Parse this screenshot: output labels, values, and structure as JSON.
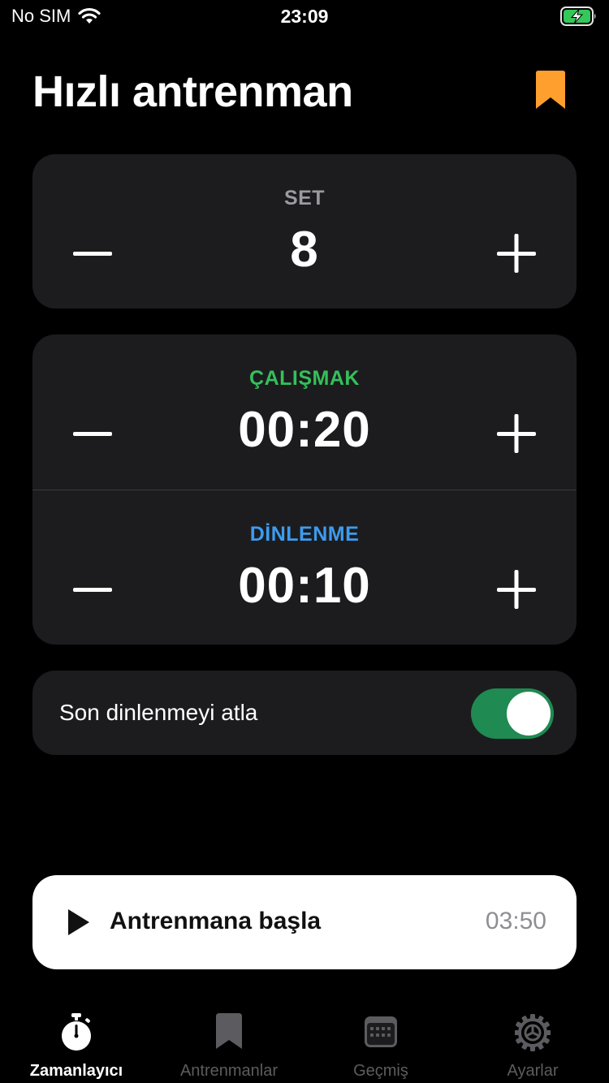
{
  "status_bar": {
    "carrier": "No SIM",
    "time": "23:09"
  },
  "header": {
    "title": "Hızlı antrenman",
    "bookmark_icon": "bookmark-icon"
  },
  "set_stepper": {
    "label": "SET",
    "value": "8"
  },
  "work_stepper": {
    "label": "ÇALIŞMAK",
    "value": "00:20"
  },
  "rest_stepper": {
    "label": "DİNLENME",
    "value": "00:10"
  },
  "skip_last_rest": {
    "label": "Son dinlenmeyi atla",
    "enabled": true
  },
  "start": {
    "label": "Antrenmana başla",
    "duration": "03:50"
  },
  "tabs": [
    {
      "label": "Zamanlayıcı",
      "icon": "stopwatch-icon",
      "active": true
    },
    {
      "label": "Antrenmanlar",
      "icon": "bookmark-icon",
      "active": false
    },
    {
      "label": "Geçmiş",
      "icon": "calendar-icon",
      "active": false
    },
    {
      "label": "Ayarlar",
      "icon": "gear-icon",
      "active": false
    }
  ],
  "colors": {
    "background": "#000000",
    "card": "#1c1c1e",
    "accent_orange": "#ff9f2e",
    "work_green": "#34c05a",
    "rest_blue": "#3d9bf0",
    "toggle_on": "#1f8a52",
    "set_label_gray": "#9a9aa0",
    "tab_inactive": "#5c5c60"
  }
}
